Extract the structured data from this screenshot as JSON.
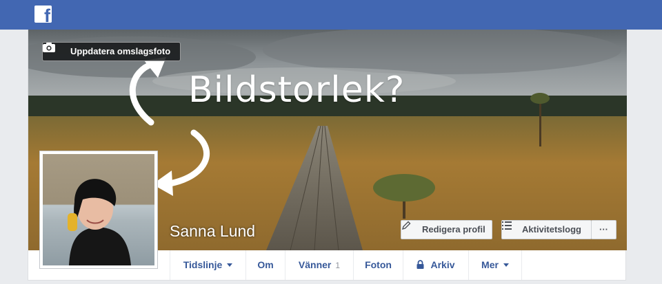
{
  "header": {
    "logo_icon": "facebook-f-icon",
    "logo_letter": "f",
    "brand_color": "#4267b2"
  },
  "cover": {
    "update_button_label": "Uppdatera omslagsfoto",
    "update_button_icon": "camera-icon",
    "overlay_text": "Bildstorlek?",
    "arrow_icons": [
      "curved-arrow-up-icon",
      "curved-arrow-left-icon"
    ]
  },
  "profile": {
    "name": "Sanna Lund",
    "edit_profile_label": "Redigera profil",
    "edit_profile_icon": "pencil-icon",
    "activity_log_label": "Aktivitetslogg",
    "activity_log_icon": "list-icon",
    "more_label": "···"
  },
  "nav": {
    "items": [
      {
        "label": "Tidslinje",
        "dropdown": true
      },
      {
        "label": "Om"
      },
      {
        "label": "Vänner",
        "count": "1"
      },
      {
        "label": "Foton"
      },
      {
        "label": "Arkiv",
        "icon": "lock-icon"
      },
      {
        "label": "Mer",
        "dropdown": true
      }
    ],
    "link_color": "#365899"
  }
}
